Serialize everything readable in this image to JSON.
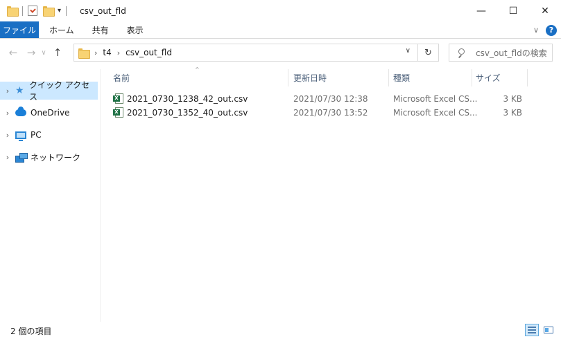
{
  "window": {
    "title": "csv_out_fld",
    "min_glyph": "—",
    "max_glyph": "☐",
    "close_glyph": "✕",
    "qa_dropdown_glyph": "▾"
  },
  "ribbon": {
    "file_tab": "ファイル",
    "tabs": [
      "ホーム",
      "共有",
      "表示"
    ],
    "expand_glyph": "∨",
    "help_glyph": "?"
  },
  "nav": {
    "back_glyph": "←",
    "forward_glyph": "→",
    "recent_glyph": "∨",
    "up_glyph": "↑",
    "breadcrumbs": [
      "t4",
      "csv_out_fld"
    ],
    "crumb_sep_glyph": "›",
    "dropdown_glyph": "∨",
    "refresh_glyph": "↻"
  },
  "search": {
    "placeholder": "csv_out_fldの検索"
  },
  "sidebar": {
    "expand_glyph": "›",
    "items": [
      {
        "label": "クイック アクセス",
        "icon": "star-icon",
        "selected": true
      },
      {
        "label": "OneDrive",
        "icon": "cloud-icon",
        "selected": false
      },
      {
        "label": "PC",
        "icon": "pc-icon",
        "selected": false
      },
      {
        "label": "ネットワーク",
        "icon": "network-icon",
        "selected": false
      }
    ]
  },
  "list": {
    "sort_glyph": "^",
    "columns": {
      "name": "名前",
      "date": "更新日時",
      "type": "種類",
      "size": "サイズ"
    },
    "files": [
      {
        "name": "2021_0730_1238_42_out.csv",
        "date": "2021/07/30 12:38",
        "type": "Microsoft Excel CS...",
        "size": "3 KB"
      },
      {
        "name": "2021_0730_1352_40_out.csv",
        "date": "2021/07/30 13:52",
        "type": "Microsoft Excel CS...",
        "size": "3 KB"
      }
    ]
  },
  "status": {
    "item_count": "2 個の項目"
  },
  "colors": {
    "accent": "#1a6fc4",
    "selection": "#cce8ff",
    "header_text": "#4c607a"
  }
}
